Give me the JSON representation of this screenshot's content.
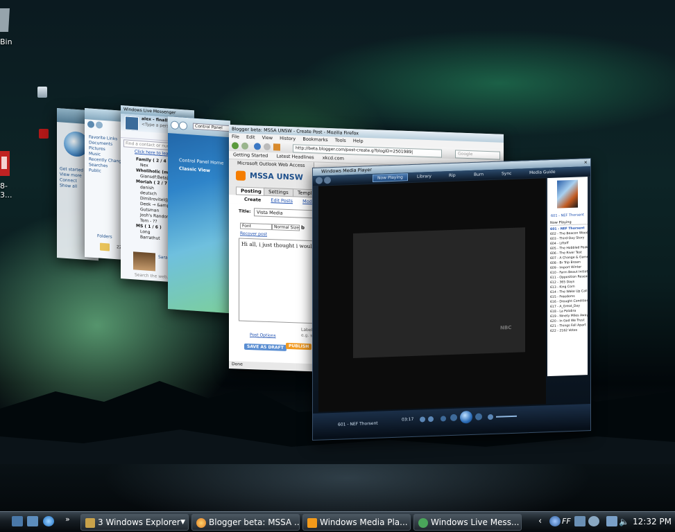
{
  "desktop": {
    "recycle_bin_label": "Bin",
    "partial_icon_label": "8-3..."
  },
  "explorer_window": {
    "sidebar_items": [
      "Favorite Links",
      "Documents",
      "Pictures",
      "Music",
      "Recently Changed",
      "Searches",
      "Public"
    ],
    "folder_label": "Folders",
    "items_count": "22 items"
  },
  "messenger_window": {
    "title": "Windows Live Messenger",
    "status_line": "alex - finally getting vista (Online)",
    "personal_message": "<Type a personal message>",
    "search_placeholder": "Find a contact or number...",
    "promo_link": "Click here to learn...",
    "groups": [
      {
        "name": "Family ( 2 / 4 )",
        "contacts": [
          "Nex"
        ]
      },
      {
        "name": "Wholiholic (ma...",
        "contacts": [
          "Giansdf:Betajfu.."
        ]
      },
      {
        "name": "Moriah ( 2 / 7 )",
        "contacts": [
          "danish",
          "deutsch",
          "Dimitrovitel@gm...",
          "Deek → &amp;lay...",
          "Gutsman",
          "Josh's Random...",
          "Tom - ??"
        ]
      },
      {
        "name": "MS ( 1 / 6 )",
        "contacts": [
          "Long",
          "Barrathut"
        ]
      }
    ],
    "profile_name": "Sarah Lo...",
    "search_web": "Search the web..."
  },
  "control_panel": {
    "address": "Control Panel",
    "links": [
      "Control Panel Home",
      "Classic View"
    ]
  },
  "firefox_window": {
    "title": "Blogger beta: MSSA UNSW - Create Post - Mozilla Firefox",
    "menu": [
      "File",
      "Edit",
      "View",
      "History",
      "Bookmarks",
      "Tools",
      "Help"
    ],
    "url": "http://beta.blogger.com/post-create.g?blogID=2501989|",
    "search_placeholder": "Google",
    "bookmarks": [
      "Getting Started",
      "Latest Headlines",
      "xkcd.com"
    ],
    "tab_label": "Microsoft Outlook Web Access",
    "blog_name": "MSSA UNSW",
    "tabs": [
      "Posting",
      "Settings",
      "Template"
    ],
    "subtabs": [
      "Create",
      "Edit Posts",
      "Moderate Com..."
    ],
    "title_label": "Title:",
    "title_value": "Vista Media",
    "font_label": "Font",
    "size_label": "Normal Size",
    "recover": "Recover post",
    "body_text": "Hi all, i just thought i would upload",
    "labels_hint": "Labels for...",
    "labels_eg": "e.g. scoot...",
    "post_options": "Post Options",
    "save_draft": "SAVE AS DRAFT",
    "publish": "PUBLISH",
    "status": "Done"
  },
  "wmp_window": {
    "title": "Windows Media Player",
    "nav_tabs": [
      "Now Playing",
      "Library",
      "Rip",
      "Burn",
      "Sync",
      "Media Guide"
    ],
    "album_caption": "601 - NEF Thorsent",
    "list_header": "Now Playing",
    "tracks": [
      "601 - NEF Thorsent",
      "602 - The Beacon Wood",
      "603 - Third-Day Story",
      "604 - Liftoff",
      "605 - The Hobbled Peak",
      "606 - The River Test",
      "607 - A Change & Game Ch...",
      "608 - Br Trip Brown",
      "609 - Import Winter",
      "610 - Farm Beaut Initiative",
      "611 - Opposition Research",
      "612 - 365 Days",
      "613 - King Corn",
      "614 - The Wake Up Call",
      "615 - Freedoms",
      "616 - Drought Conditions",
      "617 - A_Great_Day",
      "618 - La Palabra",
      "619 - Ninety Miles Away",
      "620 - In God We Trust",
      "621 - Things Fall Apart",
      "622 - 2162 Votes"
    ],
    "now_playing_text": "601 - NEF Thorsent",
    "time": "03:17",
    "watermark": "NBC"
  },
  "taskbar": {
    "buttons": [
      {
        "label": "3 Windows Explorer",
        "color": "#c9a24a"
      },
      {
        "label": "Blogger beta: MSSA ...",
        "color": "#e07a1f"
      },
      {
        "label": "Windows Media Pla...",
        "color": "#f39a1a"
      },
      {
        "label": "Windows Live Mess...",
        "color": "#4aa55a"
      }
    ],
    "language": "FF",
    "clock": "12:32 PM"
  }
}
